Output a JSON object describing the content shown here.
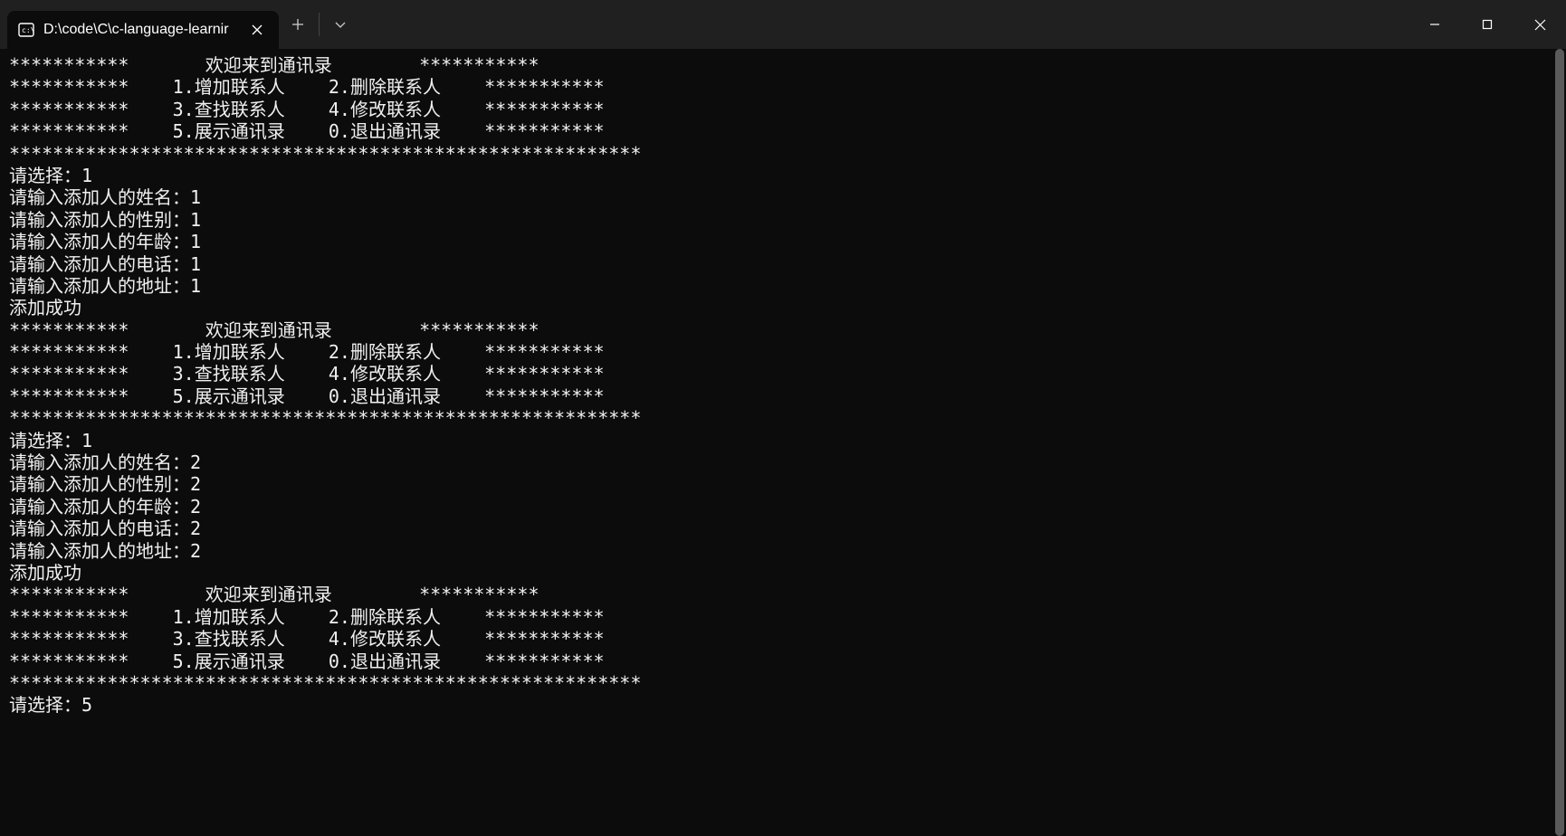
{
  "titlebar": {
    "tab_title": "D:\\code\\C\\c-language-learnir"
  },
  "terminal_lines": [
    "***********       欢迎来到通讯录        ***********",
    "***********    1.增加联系人    2.删除联系人    ***********",
    "***********    3.查找联系人    4.修改联系人    ***********",
    "***********    5.展示通讯录    0.退出通讯录    ***********",
    "**********************************************************",
    "请选择：1",
    "请输入添加人的姓名：1",
    "请输入添加人的性别：1",
    "请输入添加人的年龄：1",
    "请输入添加人的电话：1",
    "请输入添加人的地址：1",
    "添加成功",
    "***********       欢迎来到通讯录        ***********",
    "***********    1.增加联系人    2.删除联系人    ***********",
    "***********    3.查找联系人    4.修改联系人    ***********",
    "***********    5.展示通讯录    0.退出通讯录    ***********",
    "**********************************************************",
    "请选择：1",
    "请输入添加人的姓名：2",
    "请输入添加人的性别：2",
    "请输入添加人的年龄：2",
    "请输入添加人的电话：2",
    "请输入添加人的地址：2",
    "添加成功",
    "***********       欢迎来到通讯录        ***********",
    "***********    1.增加联系人    2.删除联系人    ***********",
    "***********    3.查找联系人    4.修改联系人    ***********",
    "***********    5.展示通讯录    0.退出通讯录    ***********",
    "**********************************************************",
    "请选择：5"
  ]
}
